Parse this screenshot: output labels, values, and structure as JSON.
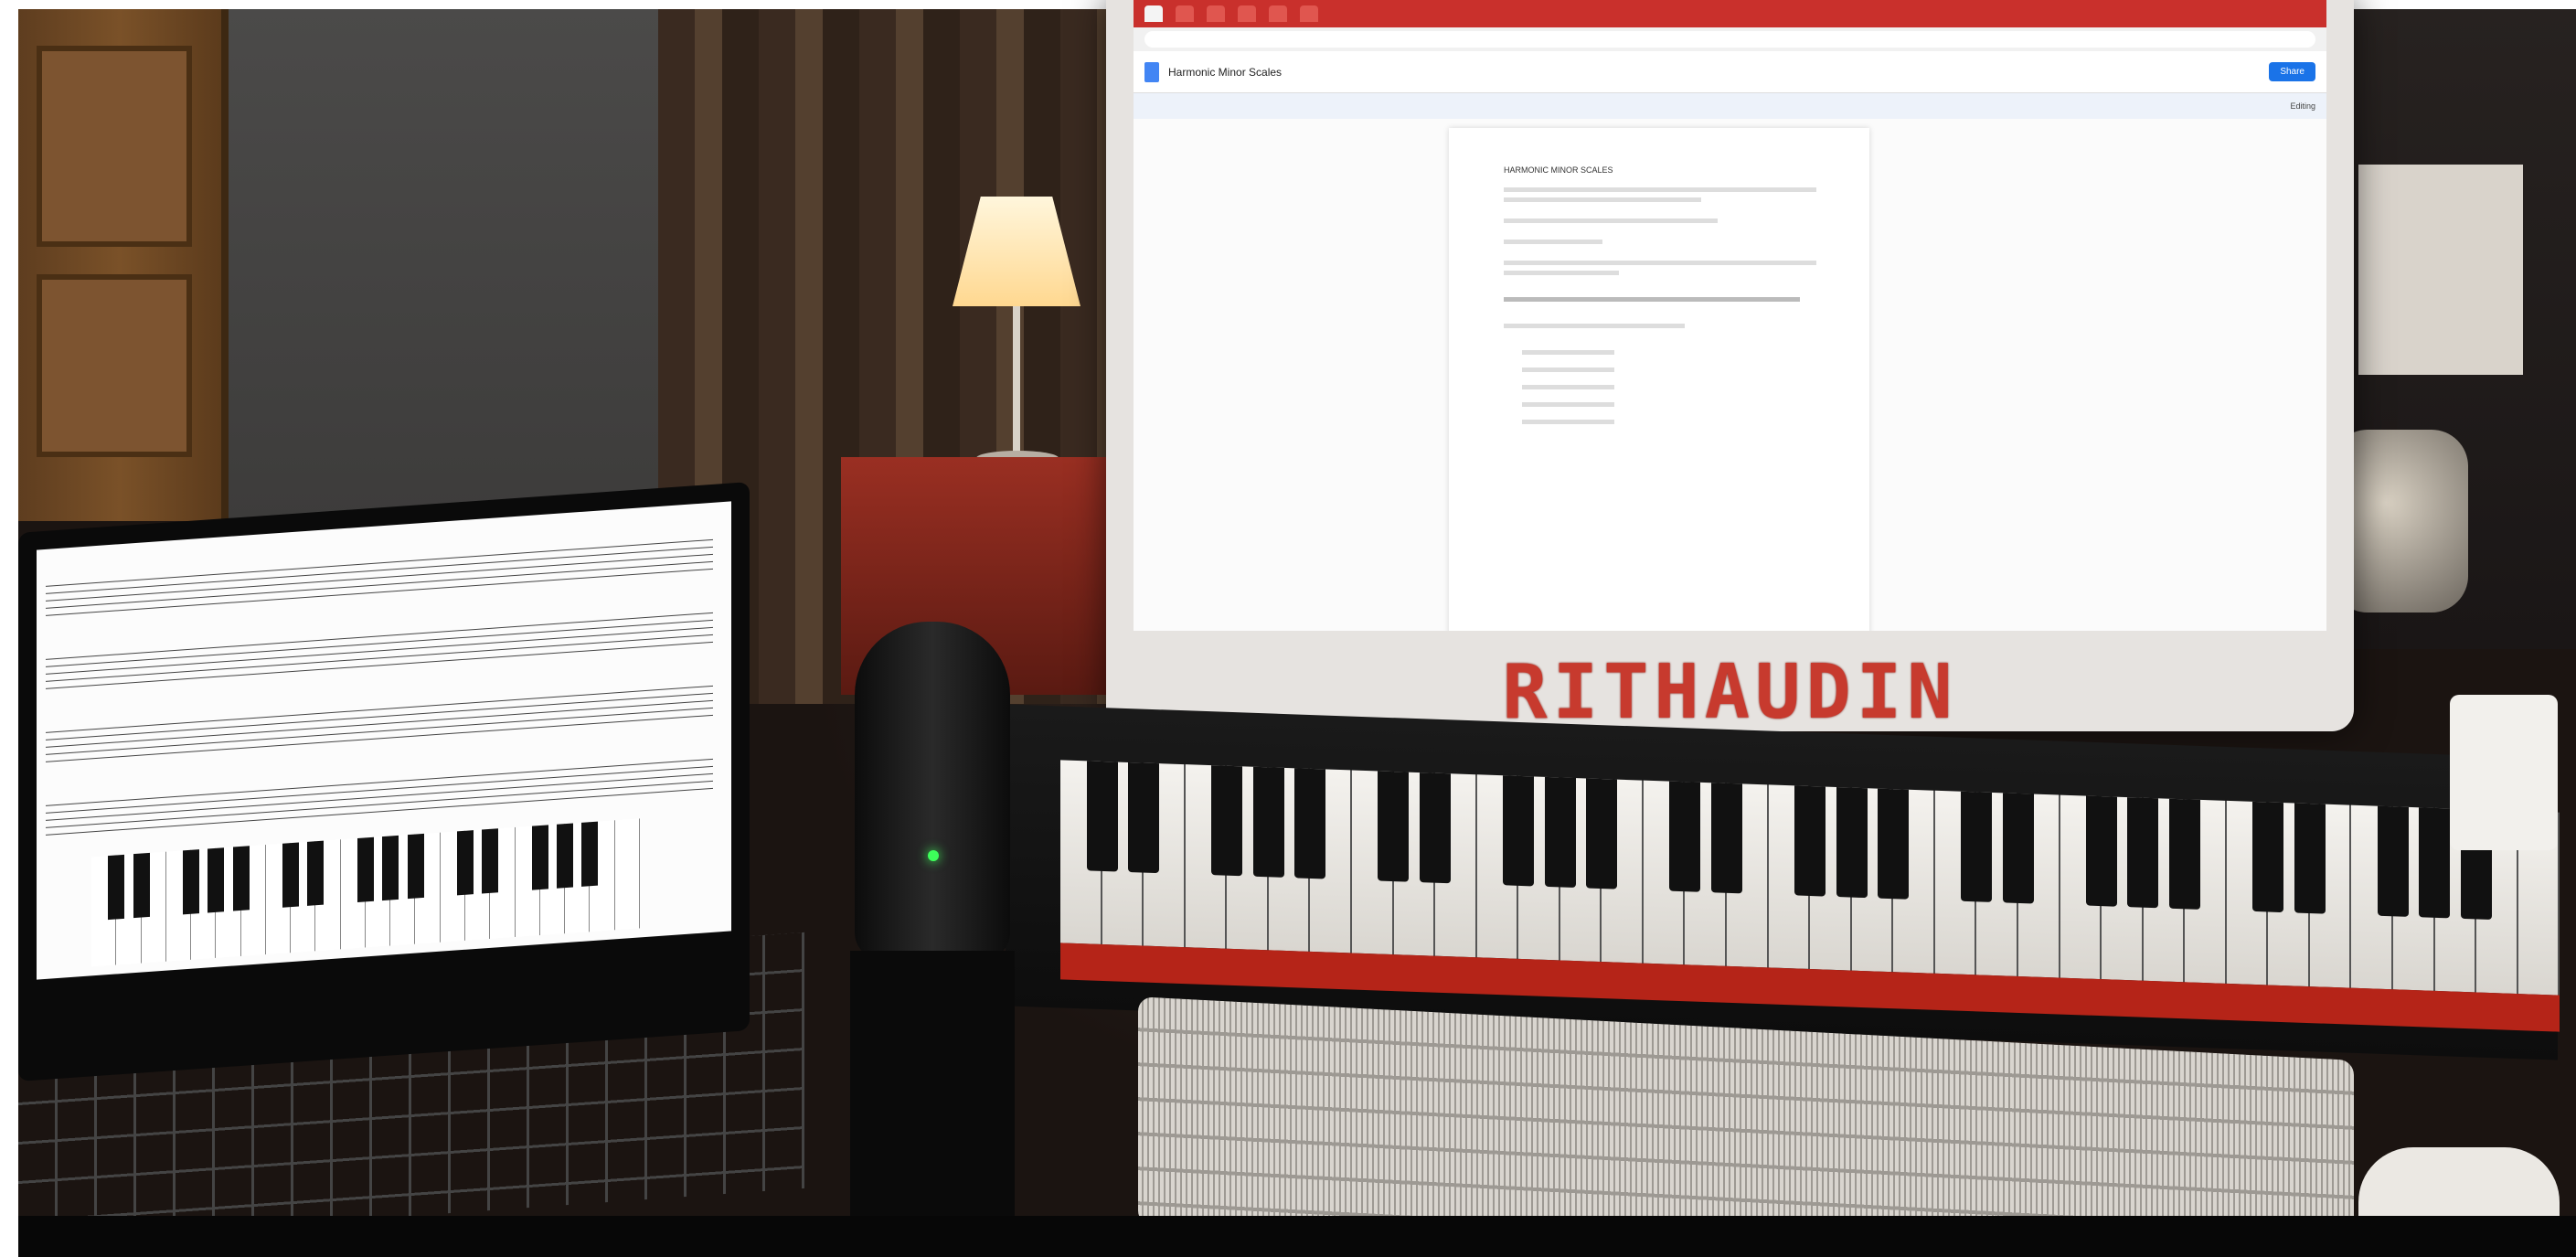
{
  "monitor": {
    "brand_text": "RITHAUDIN"
  },
  "document": {
    "title": "Harmonic Minor Scales",
    "heading": "HARMONIC MINOR SCALES",
    "share_label": "Share",
    "edit_mode": "Editing"
  }
}
